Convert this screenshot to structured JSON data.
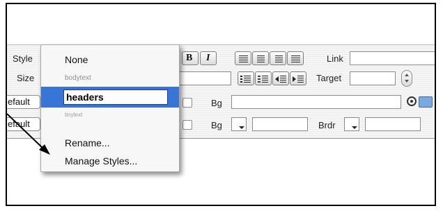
{
  "inspector": {
    "style_label": "Style",
    "size_label": "Size",
    "link_label": "Link",
    "target_label": "Target",
    "bg_label_1": "Bg",
    "bg_label_2": "Bg",
    "brdr_label": "Brdr",
    "default_1": "efault",
    "default_2": "efault",
    "bold_glyph": "B",
    "italic_glyph": "I"
  },
  "menu": {
    "items": [
      "None",
      "bodytext",
      "headers",
      "tinytext",
      "Rename...",
      "Manage Styles..."
    ],
    "selected": "headers"
  },
  "icons": [
    "target-icon",
    "folder-icon",
    "align-left-icon",
    "align-center-icon",
    "align-right-icon",
    "justify-icon",
    "unordered-list-icon",
    "ordered-list-icon",
    "outdent-icon",
    "indent-icon"
  ],
  "colors": {
    "selection": "#3875d7",
    "folder": "#7aa8e0"
  }
}
